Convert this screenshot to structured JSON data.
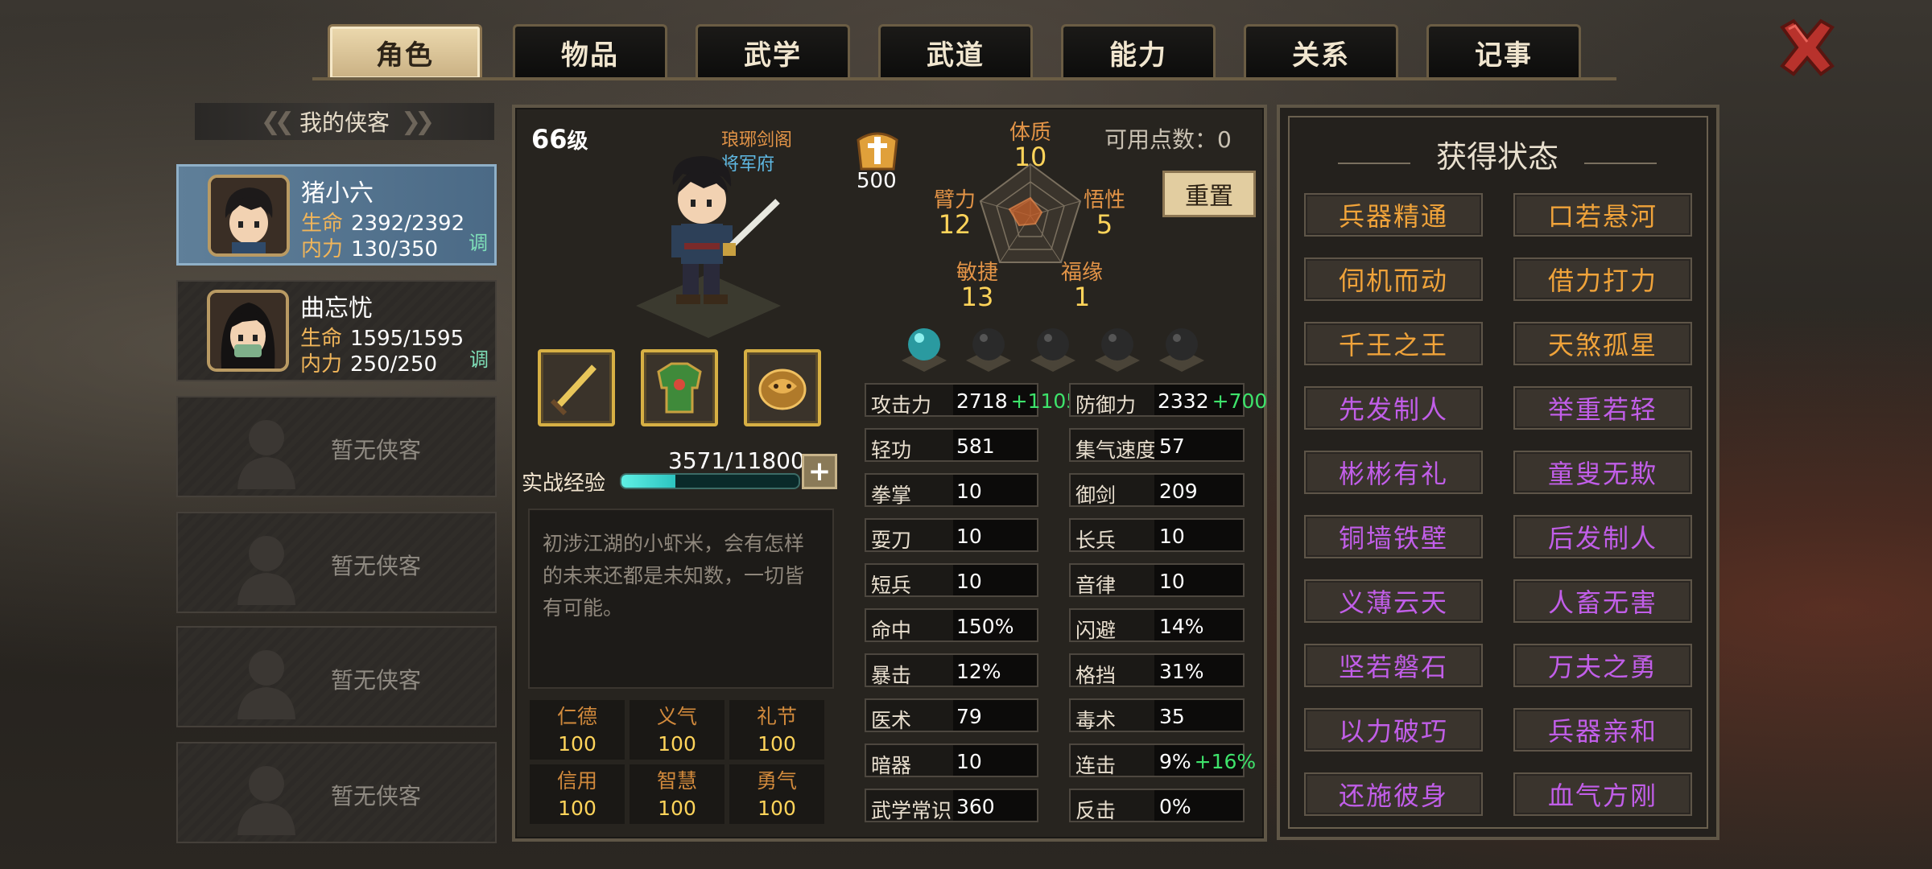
{
  "tabs": [
    {
      "label": "角色",
      "active": true
    },
    {
      "label": "物品",
      "active": false
    },
    {
      "label": "武学",
      "active": false
    },
    {
      "label": "武道",
      "active": false
    },
    {
      "label": "能力",
      "active": false
    },
    {
      "label": "关系",
      "active": false
    },
    {
      "label": "记事",
      "active": false
    }
  ],
  "roster": {
    "header": "我的侠客",
    "members": [
      {
        "name": "猪小六",
        "hp_label": "生命",
        "hp": "2392/2392",
        "mp_label": "内力",
        "mp": "130/350",
        "adjust": "调",
        "selected": true
      },
      {
        "name": "曲忘忧",
        "hp_label": "生命",
        "hp": "1595/1595",
        "mp_label": "内力",
        "mp": "250/250",
        "adjust": "调",
        "selected": false
      }
    ],
    "empty_label": "暂无侠客"
  },
  "character": {
    "level": "66",
    "level_unit": "级",
    "sect": "琅琊剑阁",
    "faction": "将军府",
    "crest_value": "500",
    "available_points_label": "可用点数：",
    "available_points": "0",
    "reset_label": "重置",
    "attributes": {
      "tizhi": {
        "name": "体质",
        "value": "10"
      },
      "bili": {
        "name": "臂力",
        "value": "12"
      },
      "wuxing": {
        "name": "悟性",
        "value": "5"
      },
      "minjie": {
        "name": "敏捷",
        "value": "13"
      },
      "fuyuan": {
        "name": "福缘",
        "value": "1"
      }
    },
    "orbs": [
      "teal",
      "dark",
      "dark",
      "dark",
      "dark"
    ],
    "equipment": [
      "sword-icon",
      "armor-icon",
      "accessory-icon"
    ],
    "exp_label": "实战经验",
    "exp": "3571/11800",
    "exp_fraction": 0.3026,
    "description": "初涉江湖的小虾米，会有怎样的未来还都是未知数，一切皆有可能。",
    "virtues": [
      {
        "name": "仁德",
        "value": "100"
      },
      {
        "name": "义气",
        "value": "100"
      },
      {
        "name": "礼节",
        "value": "100"
      },
      {
        "name": "信用",
        "value": "100"
      },
      {
        "name": "智慧",
        "value": "100"
      },
      {
        "name": "勇气",
        "value": "100"
      }
    ]
  },
  "stats_left": [
    {
      "k": "攻击力",
      "v": "2718",
      "b": "+1105"
    },
    {
      "k": "轻功",
      "v": "581",
      "b": ""
    },
    {
      "k": "拳掌",
      "v": "10",
      "b": ""
    },
    {
      "k": "耍刀",
      "v": "10",
      "b": ""
    },
    {
      "k": "短兵",
      "v": "10",
      "b": ""
    },
    {
      "k": "命中",
      "v": "150%",
      "b": ""
    },
    {
      "k": "暴击",
      "v": "12%",
      "b": ""
    },
    {
      "k": "医术",
      "v": "79",
      "b": ""
    },
    {
      "k": "暗器",
      "v": "10",
      "b": ""
    },
    {
      "k": "武学常识",
      "v": "360",
      "b": ""
    }
  ],
  "stats_right": [
    {
      "k": "防御力",
      "v": "2332",
      "b": "+700"
    },
    {
      "k": "集气速度",
      "v": "57",
      "b": ""
    },
    {
      "k": "御剑",
      "v": "209",
      "b": ""
    },
    {
      "k": "长兵",
      "v": "10",
      "b": ""
    },
    {
      "k": "音律",
      "v": "10",
      "b": ""
    },
    {
      "k": "闪避",
      "v": "14%",
      "b": ""
    },
    {
      "k": "格挡",
      "v": "31%",
      "b": ""
    },
    {
      "k": "毒术",
      "v": "35",
      "b": ""
    },
    {
      "k": "连击",
      "v": "9%",
      "b": "+16%"
    },
    {
      "k": "反击",
      "v": "0%",
      "b": ""
    }
  ],
  "status_panel": {
    "title": "获得状态",
    "buffs": [
      {
        "label": "兵器精通",
        "color": "#f0a33a"
      },
      {
        "label": "口若悬河",
        "color": "#f0a33a"
      },
      {
        "label": "伺机而动",
        "color": "#f0a33a"
      },
      {
        "label": "借力打力",
        "color": "#f0a33a"
      },
      {
        "label": "千王之王",
        "color": "#f0a33a"
      },
      {
        "label": "天煞孤星",
        "color": "#f0a33a"
      },
      {
        "label": "先发制人",
        "color": "#c15ee8"
      },
      {
        "label": "举重若轻",
        "color": "#c15ee8"
      },
      {
        "label": "彬彬有礼",
        "color": "#c15ee8"
      },
      {
        "label": "童叟无欺",
        "color": "#c15ee8"
      },
      {
        "label": "铜墙铁壁",
        "color": "#c15ee8"
      },
      {
        "label": "后发制人",
        "color": "#c15ee8"
      },
      {
        "label": "义薄云天",
        "color": "#c15ee8"
      },
      {
        "label": "人畜无害",
        "color": "#c15ee8"
      },
      {
        "label": "坚若磐石",
        "color": "#c15ee8"
      },
      {
        "label": "万夫之勇",
        "color": "#c15ee8"
      },
      {
        "label": "以力破巧",
        "color": "#c15ee8"
      },
      {
        "label": "兵器亲和",
        "color": "#c15ee8"
      },
      {
        "label": "还施彼身",
        "color": "#c15ee8"
      },
      {
        "label": "血气方刚",
        "color": "#c15ee8"
      }
    ]
  },
  "colors": {
    "gold": "#ffd45a",
    "orange": "#e39447",
    "bonus_green": "#3ee36b",
    "purple": "#c15ee8"
  }
}
